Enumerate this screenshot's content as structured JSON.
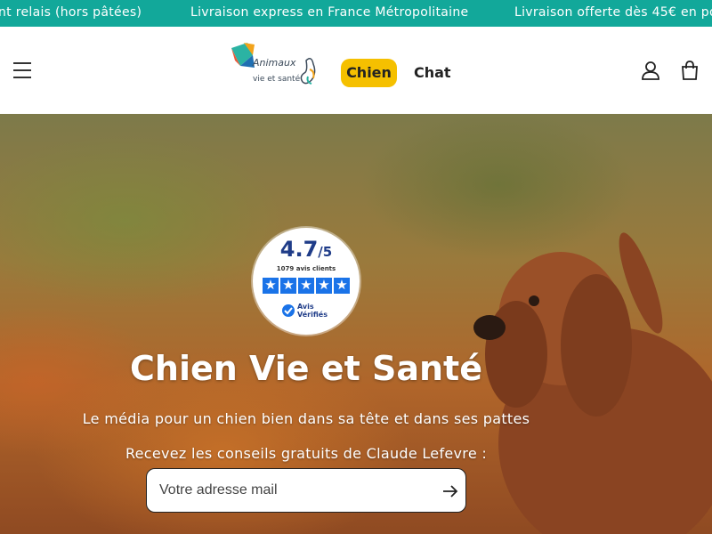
{
  "announcements": [
    "nt relais (hors pâtées)",
    "Livraison express en France Métropolitaine",
    "Livraison offerte dès 45€ en po"
  ],
  "header": {
    "logo_line1": "Animaux",
    "logo_line2": "vie et santé",
    "nav": [
      {
        "label": "Chien",
        "active": true
      },
      {
        "label": "Chat",
        "active": false
      }
    ],
    "accent_color": "#f5c000",
    "brand_color": "#12a89a",
    "icons": [
      "menu-icon",
      "account-icon",
      "cart-icon"
    ]
  },
  "rating": {
    "score": "4.7",
    "scale": "/5",
    "count": "1079 avis clients",
    "stars": 5,
    "stars_value": 4.7,
    "brand_line1": "Avis",
    "brand_line2": "Vérifiés"
  },
  "hero": {
    "title": "Chien Vie et Santé",
    "subtitle": "Le média pour un chien bien dans sa tête et dans ses pattes",
    "cta_text": "Recevez les conseils gratuits de Claude Lefevre :",
    "email_placeholder": "Votre adresse mail"
  }
}
